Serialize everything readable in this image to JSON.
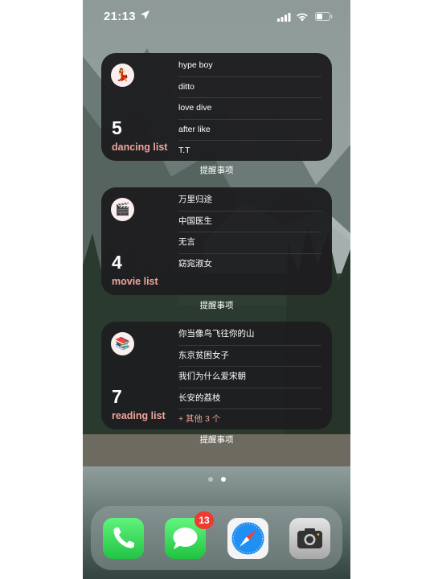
{
  "status_bar": {
    "time": "21:13",
    "icons": [
      "location-arrow-icon",
      "cellular-signal-icon",
      "wifi-icon",
      "battery-icon"
    ]
  },
  "widgets": [
    {
      "icon": "dancer-emoji-icon",
      "count": "5",
      "title": "dancing list",
      "items": [
        "hype boy",
        "ditto",
        "love dive",
        "after like",
        "T.T"
      ],
      "caption": "提醒事项"
    },
    {
      "icon": "clapperboard-emoji-icon",
      "count": "4",
      "title": "movie list",
      "items": [
        "万里归途",
        "中国医生",
        "无言",
        "窈窕淑女"
      ],
      "caption": "提醒事项"
    },
    {
      "icon": "books-emoji-icon",
      "count": "7",
      "title": "reading list",
      "items": [
        "你当像鸟飞往你的山",
        "东京贫困女子",
        "我们为什么爱宋朝",
        "长安的荔枝"
      ],
      "more": "+ 其他 3 个",
      "caption": "提醒事项"
    }
  ],
  "page_dots": {
    "count": 2,
    "active": 2
  },
  "dock": {
    "apps": [
      {
        "name": "Phone",
        "icon": "phone-icon",
        "color": "#3cd65b"
      },
      {
        "name": "Messages",
        "icon": "messages-icon",
        "color": "#37c84f",
        "badge": "13"
      },
      {
        "name": "Safari",
        "icon": "safari-compass-icon",
        "color": "#1b8df0"
      },
      {
        "name": "Camera",
        "icon": "camera-icon",
        "color": "#c9c9c9"
      }
    ]
  },
  "colors": {
    "widget_bg": "#1e1e20",
    "accent": "#f0a49c",
    "badge": "#ee3b30"
  }
}
